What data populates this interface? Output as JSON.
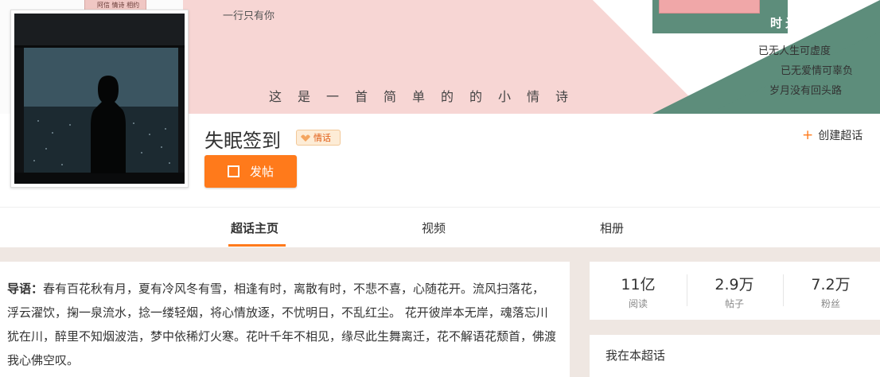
{
  "banner": {
    "top_text": "一行只有你",
    "main_text": "这是一首简单的的小情诗",
    "book_left_text": "阿信 情诗 相约",
    "poem_title": "时光迹",
    "poem_lines": [
      "已无人生可虚度",
      "已无爱情可辜负",
      "岁月没有回头路"
    ],
    "colors": {
      "pink": "#f7d6d4",
      "green": "#5d8d7b"
    }
  },
  "profile": {
    "topic_name": "失眠签到",
    "badge_text": "情话",
    "post_button_label": "发帖",
    "create_label": "创建超话"
  },
  "tabs": [
    {
      "label": "超话主页",
      "active": true
    },
    {
      "label": "视频",
      "active": false
    },
    {
      "label": "相册",
      "active": false
    }
  ],
  "intro": {
    "prefix": "导语：",
    "text": "春有百花秋有月，夏有冷风冬有雪，相逢有时，离散有时，不悲不喜，心随花开。流风扫落花，浮云濯饮，掬一泉流水，捻一缕轻烟，将心情放逐，不忧明日，不乱红尘。 花开彼岸本无岸，魂落忘川犹在川，醉里不知烟波浩，梦中依稀灯火寒。花叶千年不相见，缘尽此生舞离迁，花不解语花颓首，佛渡我心佛空叹。"
  },
  "stats": [
    {
      "value": "11亿",
      "label": "阅读"
    },
    {
      "value": "2.9万",
      "label": "帖子"
    },
    {
      "value": "7.2万",
      "label": "粉丝"
    }
  ],
  "mine": {
    "title": "我在本超话"
  },
  "accent": "#ff7a1b"
}
